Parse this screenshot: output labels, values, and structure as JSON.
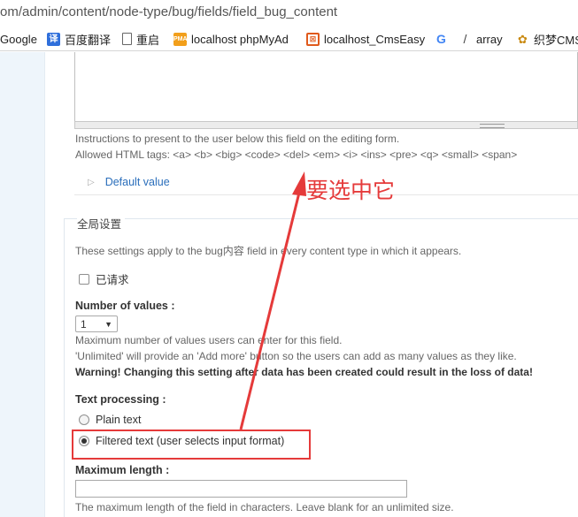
{
  "browser": {
    "url": "om/admin/content/node-type/bug/fields/field_bug_content",
    "bookmarks": [
      {
        "label": "Google",
        "icon": "google-icon"
      },
      {
        "label": "百度翻译",
        "icon": "baidu-translate-icon"
      },
      {
        "label": "重启",
        "icon": "page-icon"
      },
      {
        "label": "localhost phpMyAd",
        "icon": "pma-icon"
      },
      {
        "label": "localhost_CmsEasy",
        "icon": "cmseasy-icon"
      },
      {
        "label": "",
        "icon": "google-g-icon"
      },
      {
        "label": "array",
        "icon": "slash-icon"
      },
      {
        "label": "织梦CMS",
        "icon": "dedecms-icon"
      }
    ]
  },
  "instructions": {
    "help_line1": "Instructions to present to the user below this field on the editing form.",
    "help_line2": "Allowed HTML tags: <a> <b> <big> <code> <del> <em> <i> <ins> <pre> <q> <small> <span>"
  },
  "default_value": {
    "label": "Default value"
  },
  "global_settings": {
    "legend": "全局设置",
    "description": "These settings apply to the bug内容 field in every content type in which it appears.",
    "required_label": "已请求",
    "required_checked": false,
    "number_of_values_label": "Number of values :",
    "number_of_values_selected": "1",
    "number_help_1": "Maximum number of values users can enter for this field.",
    "number_help_2": "'Unlimited' will provide an 'Add more' button so the users can add as many values as they like.",
    "warning": "Warning! Changing this setting after data has been created could result in the loss of data!",
    "text_processing_label": "Text processing :",
    "text_processing_options": [
      {
        "label": "Plain text",
        "selected": false
      },
      {
        "label": "Filtered text (user selects input format)",
        "selected": true
      }
    ],
    "max_length_label": "Maximum length :",
    "max_length_value": "",
    "max_length_help": "The maximum length of the field in characters. Leave blank for an unlimited size."
  },
  "annotation": {
    "text": "要选中它",
    "color": "#e53a3a"
  }
}
